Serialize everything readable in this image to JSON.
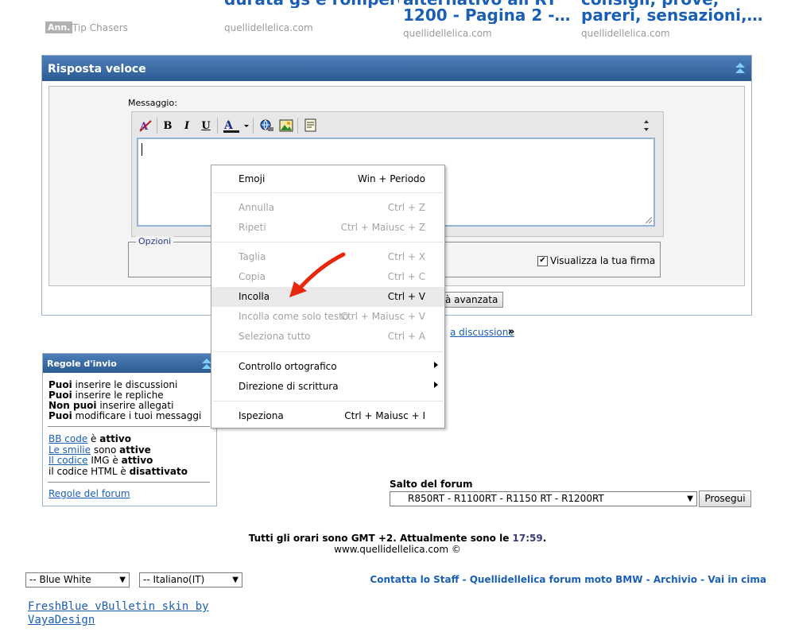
{
  "ads": [
    {
      "title": "durata gs e rompere",
      "source": "quellidellelica.com",
      "badge": "Ann.",
      "sponsor": "Tip Chasers"
    },
    {
      "title_line1": "alternativo all RT",
      "title_line2": "1200 - Pagina 2 -…",
      "source": "quellidellelica.com"
    },
    {
      "title_line1": "consigli, prove,",
      "title_line2": "pareri, sensazioni,…",
      "source": "quellidellelica.com"
    }
  ],
  "quick_reply": {
    "title": "Risposta veloce",
    "message_label": "Messaggio:",
    "options_legend": "Opzioni",
    "signature_label": "Visualizza la tua firma",
    "signature_checked": true,
    "advanced_button": "à avanzata"
  },
  "goto_link": "a discussione",
  "goto_suffix": "»",
  "context_menu": {
    "items": [
      {
        "label": "Emoji",
        "shortcut": "Win + Periodo",
        "enabled": true
      },
      {
        "label": "Annulla",
        "shortcut": "Ctrl + Z",
        "enabled": false
      },
      {
        "label": "Ripeti",
        "shortcut": "Ctrl + Maiusc + Z",
        "enabled": false
      },
      {
        "label": "Taglia",
        "shortcut": "Ctrl + X",
        "enabled": false
      },
      {
        "label": "Copia",
        "shortcut": "Ctrl + C",
        "enabled": false
      },
      {
        "label": "Incolla",
        "shortcut": "Ctrl + V",
        "enabled": true,
        "highlighted": true
      },
      {
        "label": "Incolla come solo testo",
        "shortcut": "Ctrl + Maiusc + V",
        "enabled": false
      },
      {
        "label": "Seleziona tutto",
        "shortcut": "Ctrl + A",
        "enabled": false
      },
      {
        "label": "Controllo ortografico",
        "shortcut": "",
        "enabled": true,
        "submenu": true
      },
      {
        "label": "Direzione di scrittura",
        "shortcut": "",
        "enabled": true,
        "submenu": true
      },
      {
        "label": "Ispeziona",
        "shortcut": "Ctrl + Maiusc + I",
        "enabled": true
      }
    ]
  },
  "rules": {
    "title": "Regole d'invio",
    "lines": [
      {
        "strong": "Puoi",
        "rest": " inserire le discussioni"
      },
      {
        "strong": "Puoi",
        "rest": " inserire le repliche"
      },
      {
        "strong": "Non puoi",
        "rest": " inserire allegati"
      },
      {
        "strong": "Puoi",
        "rest": " modificare i tuoi messaggi"
      }
    ],
    "bbcode_link": "BB code",
    "bbcode_mid": " è ",
    "bbcode_state": "attivo",
    "smilies_link": "Le smilie",
    "smilies_mid": " sono ",
    "smilies_state": "attive",
    "img_link": "Il codice",
    "img_mid": " IMG è ",
    "img_state": "attivo",
    "html_pre": "il codice HTML è ",
    "html_state": "disattivato",
    "rules_link": "Regole del forum"
  },
  "forum_jump": {
    "label": "Salto del forum",
    "selected": "R850RT - R1100RT - R1150 RT - R1200RT",
    "button": "Prosegui"
  },
  "footer": {
    "time_prefix": "Tutti gli orari sono GMT +2. Attualmente sono le",
    "time_value": "17:59",
    "time_suffix": ".",
    "site": "www.quellidellelica.com ©",
    "style_select": "-- Blue White",
    "lang_select": "-- Italiano(IT)",
    "links": [
      "Contatta lo Staff",
      "Quellidellelica forum moto BMW",
      "Archivio",
      "Vai in cima"
    ],
    "separator": " - ",
    "credit_line1": "FreshBlue vBulletin skin by",
    "credit_line2": "VayaDesign"
  },
  "colors": {
    "link": "#1a5fb4",
    "header_blue": "#2c5b93",
    "annotation_arrow": "#e8280c"
  },
  "icons": {
    "toolbar": [
      "remove-format-icon",
      "bold-icon",
      "italic-icon",
      "underline-icon",
      "font-color-icon",
      "insert-link-icon",
      "insert-image-icon",
      "quote-icon",
      "resize-icon"
    ]
  }
}
